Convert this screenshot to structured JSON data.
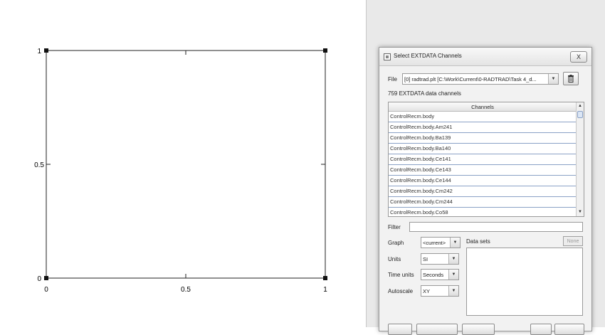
{
  "plot": {
    "y_ticks": [
      "1",
      "0.5",
      "0"
    ],
    "x_ticks": [
      "0",
      "0.5",
      "1"
    ]
  },
  "dialog": {
    "title": "Select EXTDATA Channels",
    "close_label": "X",
    "file_label": "File",
    "file_value": "[0] radtrad.plt [C:\\Work\\Current\\0-RADTRAD\\Task 4_d...",
    "channel_count": "759 EXTDATA data channels",
    "channels_header": "Channels",
    "channels": [
      "ControlRecm.body",
      "ControlRecm.body.Am241",
      "ControlRecm.body.Ba139",
      "ControlRecm.body.Ba140",
      "ControlRecm.body.Ce141",
      "ControlRecm.body.Ce143",
      "ControlRecm.body.Ce144",
      "ControlRecm.body.Cm242",
      "ControlRecm.body.Cm244",
      "ControlRecm.body.Co58"
    ],
    "filter_label": "Filter",
    "filter_value": "",
    "graph_label": "Graph",
    "graph_value": "<current>",
    "units_label": "Units",
    "units_value": "SI",
    "time_units_label": "Time units",
    "time_units_value": "Seconds",
    "autoscale_label": "Autoscale",
    "autoscale_value": "XY",
    "data_sets_label": "Data sets",
    "none_label": "None"
  },
  "icons": {
    "dialog": "window-icon",
    "delete": "trash-icon",
    "combo": "chevron-down-icon"
  }
}
